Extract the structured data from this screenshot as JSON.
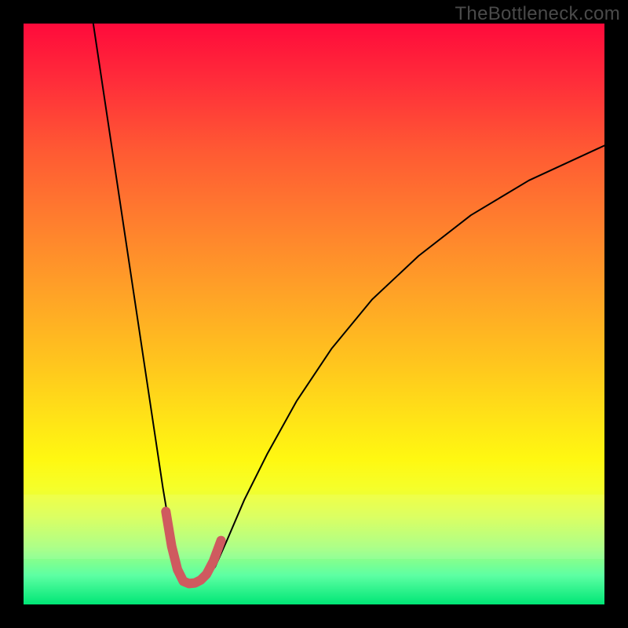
{
  "watermark": {
    "text": "TheBottleneck.com"
  },
  "chart_data": {
    "type": "line",
    "title": "",
    "xlabel": "",
    "ylabel": "",
    "xlim": [
      0,
      100
    ],
    "ylim": [
      0,
      100
    ],
    "grid": false,
    "legend": false,
    "band": {
      "y_from": 7.8,
      "y_to": 18.9
    },
    "series": [
      {
        "name": "curve",
        "stroke": "#000000",
        "stroke_width": 2,
        "x": [
          12.0,
          13.5,
          15.0,
          16.5,
          18.0,
          19.5,
          21.0,
          22.5,
          24.0,
          25.5,
          26.5,
          27.5,
          29.0,
          31.0,
          33.0,
          35.0,
          38.0,
          42.0,
          47.0,
          53.0,
          60.0,
          68.0,
          77.0,
          87.0,
          100.0
        ],
        "y": [
          100.0,
          90.0,
          80.0,
          70.0,
          60.0,
          50.0,
          40.0,
          30.0,
          20.0,
          11.0,
          6.0,
          3.8,
          3.5,
          4.0,
          6.5,
          11.0,
          18.0,
          26.0,
          35.0,
          44.0,
          52.5,
          60.0,
          67.0,
          73.0,
          79.0
        ]
      },
      {
        "name": "bottom-marker",
        "stroke": "#cf5a5f",
        "stroke_width": 12,
        "linecap": "round",
        "x": [
          24.5,
          25.5,
          26.5,
          27.5,
          28.5,
          29.5,
          30.5,
          31.5,
          32.7,
          34.0
        ],
        "y": [
          16.0,
          10.0,
          6.0,
          4.0,
          3.6,
          3.7,
          4.2,
          5.2,
          7.5,
          11.0
        ]
      }
    ],
    "background_gradient": {
      "direction": "vertical",
      "stops": [
        {
          "pos": 0.0,
          "color": "#ff0a3b"
        },
        {
          "pos": 0.1,
          "color": "#ff2d3a"
        },
        {
          "pos": 0.22,
          "color": "#ff5a33"
        },
        {
          "pos": 0.34,
          "color": "#ff7e2e"
        },
        {
          "pos": 0.46,
          "color": "#ffa127"
        },
        {
          "pos": 0.58,
          "color": "#ffc41e"
        },
        {
          "pos": 0.68,
          "color": "#ffe317"
        },
        {
          "pos": 0.75,
          "color": "#fff811"
        },
        {
          "pos": 0.8,
          "color": "#f5ff2a"
        },
        {
          "pos": 0.85,
          "color": "#d7ff52"
        },
        {
          "pos": 0.9,
          "color": "#a6ff7a"
        },
        {
          "pos": 0.95,
          "color": "#5dffa3"
        },
        {
          "pos": 1.0,
          "color": "#00e676"
        }
      ]
    }
  }
}
